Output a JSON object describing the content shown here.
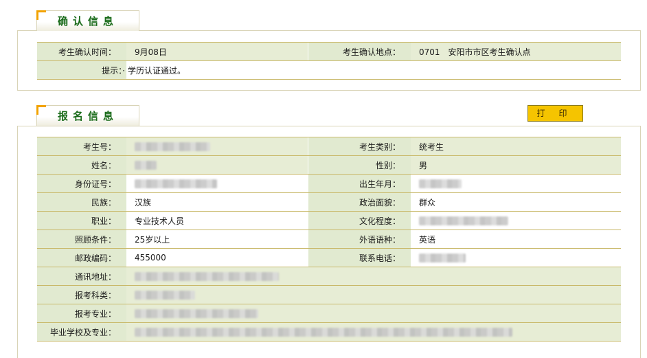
{
  "confirm": {
    "title": "确认信息",
    "time_label": "考生确认时间：",
    "time_value": "9月08日",
    "place_label": "考生确认地点：",
    "place_value": "0701　安阳市市区考生确认点",
    "hint_label": "提示：·",
    "hint_value": "学历认证通过。"
  },
  "registration": {
    "title": "报名信息",
    "print_label": "打印",
    "labels": {
      "exam_no": "考生号：",
      "category": "考生类别：",
      "name": "姓名：",
      "gender": "性别：",
      "id_no": "身份证号：",
      "birth": "出生年月：",
      "ethnic": "民族：",
      "political": "政治面貌：",
      "job": "职业：",
      "education": "文化程度：",
      "care": "照顾条件：",
      "language": "外语语种：",
      "postcode": "邮政编码：",
      "phone": "联系电话：",
      "address": "通讯地址：",
      "subject_type": "报考科类：",
      "major": "报考专业：",
      "school": "毕业学校及专业："
    },
    "values": {
      "category": "统考生",
      "gender": "男",
      "ethnic": "汉族",
      "political": "群众",
      "job": "专业技术人员",
      "care": "25岁以上",
      "language": "英语",
      "postcode": "455000"
    }
  }
}
